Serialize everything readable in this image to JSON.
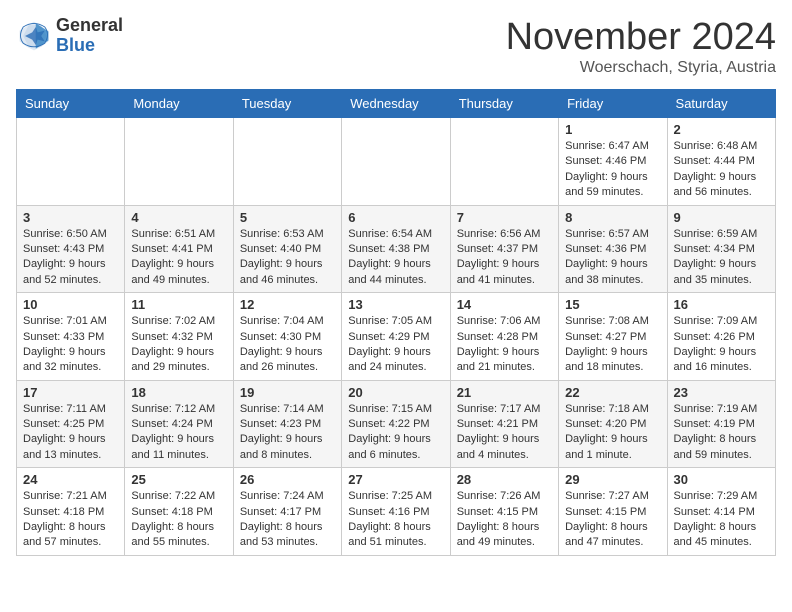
{
  "logo": {
    "general": "General",
    "blue": "Blue"
  },
  "header": {
    "month": "November 2024",
    "location": "Woerschach, Styria, Austria"
  },
  "weekdays": [
    "Sunday",
    "Monday",
    "Tuesday",
    "Wednesday",
    "Thursday",
    "Friday",
    "Saturday"
  ],
  "weeks": [
    [
      {
        "day": "",
        "info": ""
      },
      {
        "day": "",
        "info": ""
      },
      {
        "day": "",
        "info": ""
      },
      {
        "day": "",
        "info": ""
      },
      {
        "day": "",
        "info": ""
      },
      {
        "day": "1",
        "info": "Sunrise: 6:47 AM\nSunset: 4:46 PM\nDaylight: 9 hours\nand 59 minutes."
      },
      {
        "day": "2",
        "info": "Sunrise: 6:48 AM\nSunset: 4:44 PM\nDaylight: 9 hours\nand 56 minutes."
      }
    ],
    [
      {
        "day": "3",
        "info": "Sunrise: 6:50 AM\nSunset: 4:43 PM\nDaylight: 9 hours\nand 52 minutes."
      },
      {
        "day": "4",
        "info": "Sunrise: 6:51 AM\nSunset: 4:41 PM\nDaylight: 9 hours\nand 49 minutes."
      },
      {
        "day": "5",
        "info": "Sunrise: 6:53 AM\nSunset: 4:40 PM\nDaylight: 9 hours\nand 46 minutes."
      },
      {
        "day": "6",
        "info": "Sunrise: 6:54 AM\nSunset: 4:38 PM\nDaylight: 9 hours\nand 44 minutes."
      },
      {
        "day": "7",
        "info": "Sunrise: 6:56 AM\nSunset: 4:37 PM\nDaylight: 9 hours\nand 41 minutes."
      },
      {
        "day": "8",
        "info": "Sunrise: 6:57 AM\nSunset: 4:36 PM\nDaylight: 9 hours\nand 38 minutes."
      },
      {
        "day": "9",
        "info": "Sunrise: 6:59 AM\nSunset: 4:34 PM\nDaylight: 9 hours\nand 35 minutes."
      }
    ],
    [
      {
        "day": "10",
        "info": "Sunrise: 7:01 AM\nSunset: 4:33 PM\nDaylight: 9 hours\nand 32 minutes."
      },
      {
        "day": "11",
        "info": "Sunrise: 7:02 AM\nSunset: 4:32 PM\nDaylight: 9 hours\nand 29 minutes."
      },
      {
        "day": "12",
        "info": "Sunrise: 7:04 AM\nSunset: 4:30 PM\nDaylight: 9 hours\nand 26 minutes."
      },
      {
        "day": "13",
        "info": "Sunrise: 7:05 AM\nSunset: 4:29 PM\nDaylight: 9 hours\nand 24 minutes."
      },
      {
        "day": "14",
        "info": "Sunrise: 7:06 AM\nSunset: 4:28 PM\nDaylight: 9 hours\nand 21 minutes."
      },
      {
        "day": "15",
        "info": "Sunrise: 7:08 AM\nSunset: 4:27 PM\nDaylight: 9 hours\nand 18 minutes."
      },
      {
        "day": "16",
        "info": "Sunrise: 7:09 AM\nSunset: 4:26 PM\nDaylight: 9 hours\nand 16 minutes."
      }
    ],
    [
      {
        "day": "17",
        "info": "Sunrise: 7:11 AM\nSunset: 4:25 PM\nDaylight: 9 hours\nand 13 minutes."
      },
      {
        "day": "18",
        "info": "Sunrise: 7:12 AM\nSunset: 4:24 PM\nDaylight: 9 hours\nand 11 minutes."
      },
      {
        "day": "19",
        "info": "Sunrise: 7:14 AM\nSunset: 4:23 PM\nDaylight: 9 hours\nand 8 minutes."
      },
      {
        "day": "20",
        "info": "Sunrise: 7:15 AM\nSunset: 4:22 PM\nDaylight: 9 hours\nand 6 minutes."
      },
      {
        "day": "21",
        "info": "Sunrise: 7:17 AM\nSunset: 4:21 PM\nDaylight: 9 hours\nand 4 minutes."
      },
      {
        "day": "22",
        "info": "Sunrise: 7:18 AM\nSunset: 4:20 PM\nDaylight: 9 hours\nand 1 minute."
      },
      {
        "day": "23",
        "info": "Sunrise: 7:19 AM\nSunset: 4:19 PM\nDaylight: 8 hours\nand 59 minutes."
      }
    ],
    [
      {
        "day": "24",
        "info": "Sunrise: 7:21 AM\nSunset: 4:18 PM\nDaylight: 8 hours\nand 57 minutes."
      },
      {
        "day": "25",
        "info": "Sunrise: 7:22 AM\nSunset: 4:18 PM\nDaylight: 8 hours\nand 55 minutes."
      },
      {
        "day": "26",
        "info": "Sunrise: 7:24 AM\nSunset: 4:17 PM\nDaylight: 8 hours\nand 53 minutes."
      },
      {
        "day": "27",
        "info": "Sunrise: 7:25 AM\nSunset: 4:16 PM\nDaylight: 8 hours\nand 51 minutes."
      },
      {
        "day": "28",
        "info": "Sunrise: 7:26 AM\nSunset: 4:15 PM\nDaylight: 8 hours\nand 49 minutes."
      },
      {
        "day": "29",
        "info": "Sunrise: 7:27 AM\nSunset: 4:15 PM\nDaylight: 8 hours\nand 47 minutes."
      },
      {
        "day": "30",
        "info": "Sunrise: 7:29 AM\nSunset: 4:14 PM\nDaylight: 8 hours\nand 45 minutes."
      }
    ]
  ]
}
